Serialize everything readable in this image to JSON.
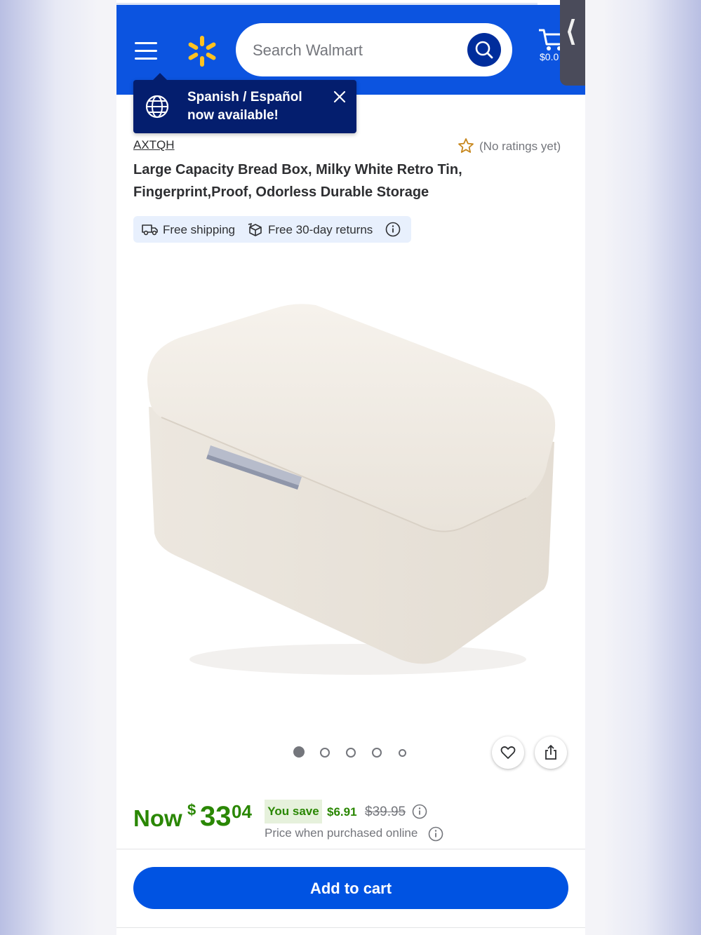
{
  "header": {
    "search_placeholder": "Search Walmart",
    "cart_amount": "$0.0",
    "brand_color": "#0c54e0",
    "spark_color": "#ffc220"
  },
  "tooltip": {
    "line1": "Spanish / Español",
    "line2": "now available!"
  },
  "product": {
    "brand": "AXTQH",
    "rating_text": "(No ratings yet)",
    "title_line1": "Large Capacity Bread Box, Milky White Retro Tin,",
    "title_line2": "Fingerprint,Proof, Odorless Durable Storage",
    "benefits": {
      "shipping": "Free shipping",
      "returns": "Free 30-day returns"
    },
    "image_count": 5,
    "active_image_index": 0
  },
  "price": {
    "prefix": "Now",
    "currency": "$",
    "dollars": "33",
    "cents": "04",
    "you_save_label": "You save",
    "save_amount": "$6.91",
    "was_price": "$39.95",
    "online_note": "Price when purchased online",
    "price_color": "#2a8703"
  },
  "actions": {
    "add_to_cart": "Add to cart"
  }
}
